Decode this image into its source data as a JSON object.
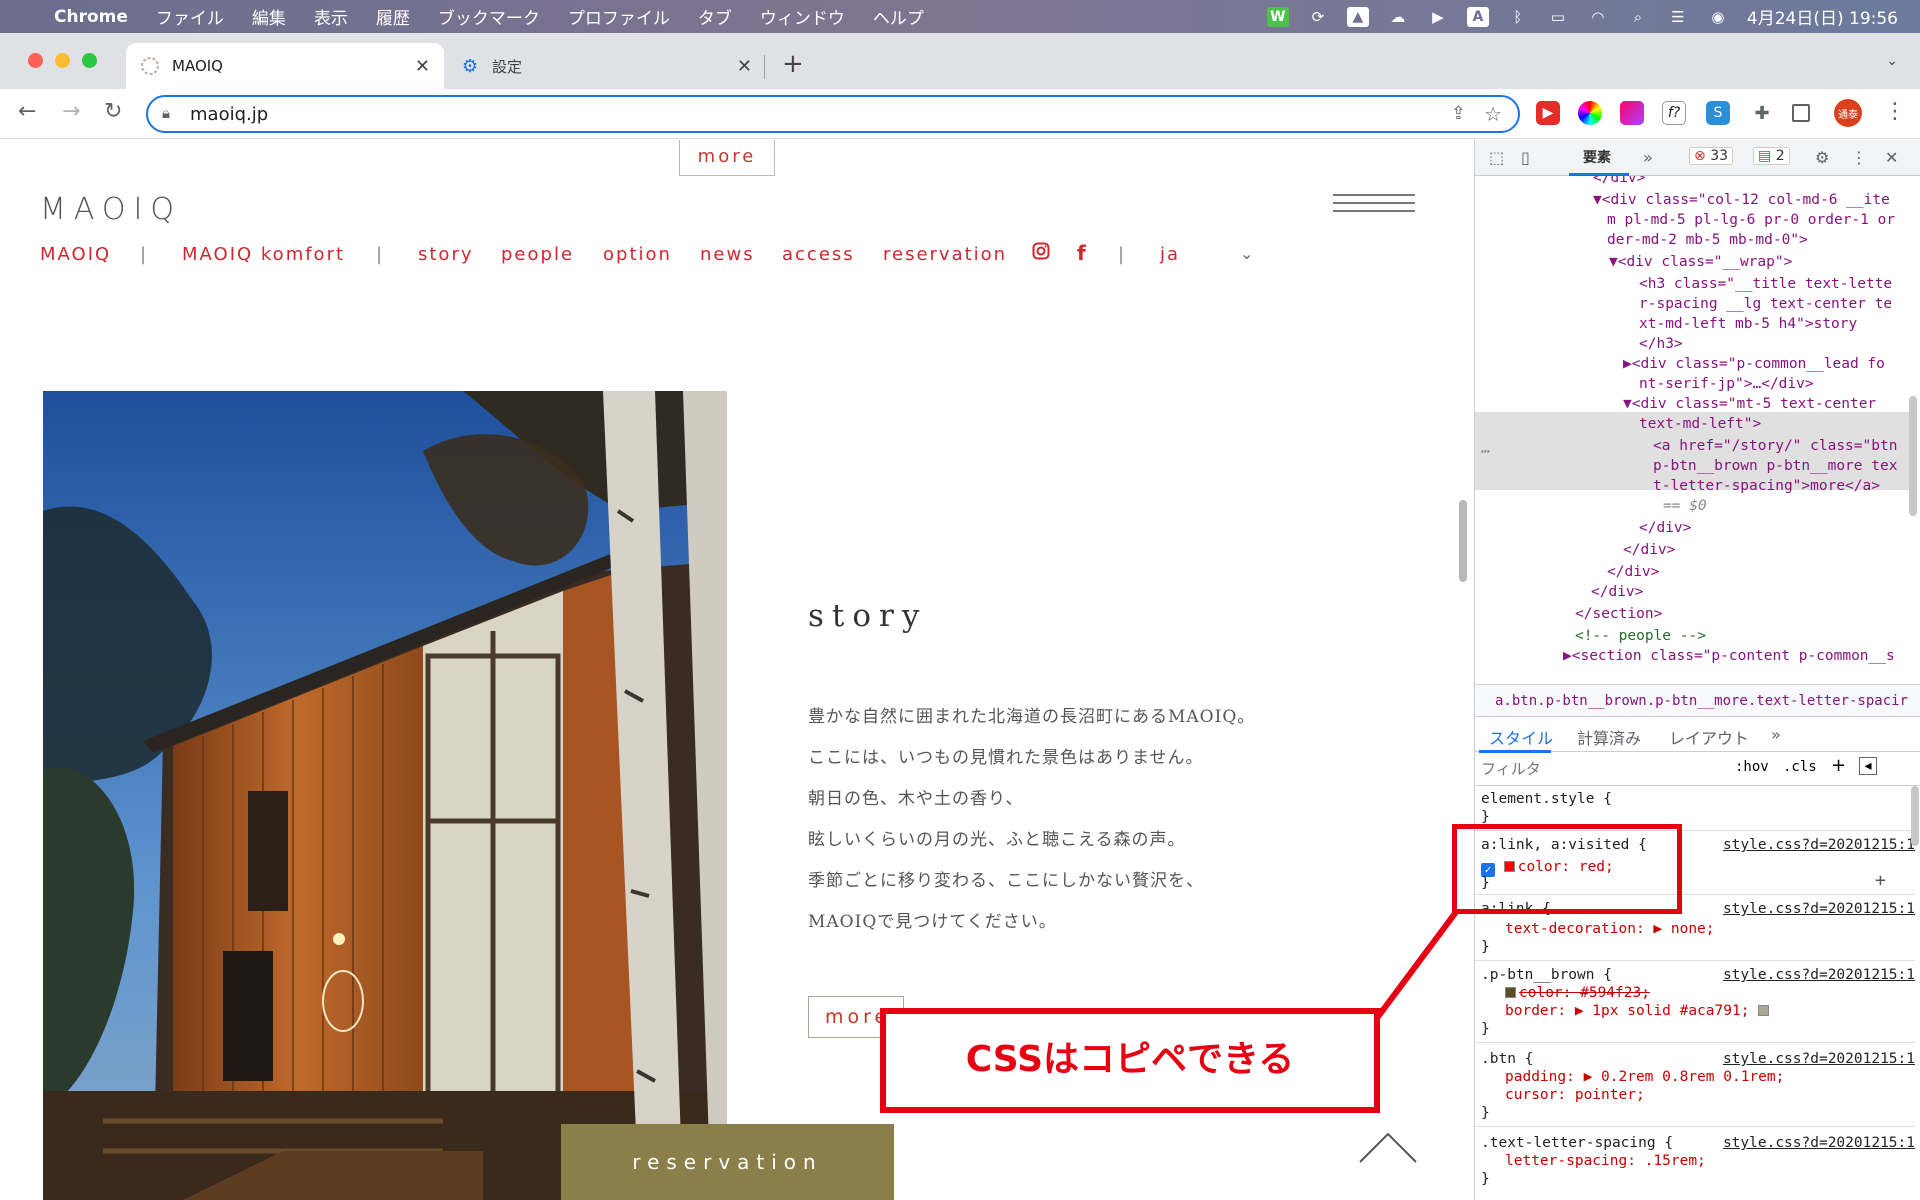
{
  "menubar": {
    "items": [
      "Chrome",
      "ファイル",
      "編集",
      "表示",
      "履歴",
      "ブックマーク",
      "プロファイル",
      "タブ",
      "ウィンドウ",
      "ヘルプ"
    ],
    "datetime": "4月24日(日) 19:56"
  },
  "tabs": [
    {
      "title": "MAOIQ"
    },
    {
      "title": "設定"
    }
  ],
  "address": {
    "url": "maoiq.jp"
  },
  "profile": {
    "badge": "通泰"
  },
  "page": {
    "more_top": "more",
    "logo": "MAOIQ",
    "nav": [
      "MAOIQ",
      "|",
      "MAOIQ komfort",
      "|",
      "story",
      "people",
      "option",
      "news",
      "access",
      "reservation",
      "|",
      "ja"
    ],
    "story_title": "story",
    "story_lines": [
      "豊かな自然に囲まれた北海道の長沼町にあるMAOIQ。",
      "ここには、いつもの見慣れた景色はありません。",
      "朝日の色、木や土の香り、",
      "眩しいくらいの月の光、ふと聴こえる森の声。",
      "季節ごとに移り変わる、ここにしかない贅沢を、",
      "MAOIQで見つけてください。"
    ],
    "more_button": "more",
    "reservation_button": "reservation"
  },
  "callout": {
    "text": "CSSはコピペできる",
    "color": "#e60012"
  },
  "devtools": {
    "tab_elements": "要素",
    "tab_more": "»",
    "errors": "33",
    "messages": "2",
    "dom_lines": [
      "</div>",
      "▼<div class=\"col-12 col-md-6 __ite",
      "m pl-md-5 pl-lg-6 pr-0 order-1 or",
      "der-md-2 mb-5 mb-md-0\">",
      "▼<div class=\"__wrap\">",
      "<h3 class=\"__title text-lette",
      "r-spacing __lg text-center te",
      "xt-md-left mb-5 h4\">story",
      "</h3>",
      "▶<div class=\"p-common__lead fo",
      "nt-serif-jp\">…</div>",
      "▼<div class=\"mt-5 text-center",
      "text-md-left\">",
      "<a href=\"/story/\" class=\"btn",
      "p-btn__brown p-btn__more tex",
      "t-letter-spacing\">more</a>",
      "== $0",
      "</div>",
      "</div>",
      "</div>",
      "</div>",
      "</section>",
      "<!-- people -->",
      "▶<section class=\"p-content p-common__s"
    ],
    "breadcrumb": "a.btn.p-btn__brown.p-btn__more.text-letter-spacir",
    "subtabs": [
      "スタイル",
      "計算済み",
      "レイアウト",
      "»"
    ],
    "filter_placeholder": "フィルタ",
    "hov": ":hov",
    "cls": ".cls",
    "rules": [
      {
        "selector": "element.style {",
        "source": "",
        "decls": [],
        "close": "}"
      },
      {
        "selector": "a:link, a:visited {",
        "source": "style.css?d=20201215:1",
        "decls": [
          {
            "text": "color: red;",
            "color": "#ff0000"
          }
        ],
        "close": "}"
      },
      {
        "selector": "a:link {",
        "source": "style.css?d=20201215:1",
        "decls": [
          {
            "text": "text-decoration: ▶ none;"
          }
        ],
        "close": "}"
      },
      {
        "selector": ".p-btn__brown {",
        "source": "style.css?d=20201215:1",
        "decls": [
          {
            "text": "color: #594f23;",
            "color": "#594f23",
            "struck": true
          },
          {
            "text": "border: ▶ 1px solid #aca791;",
            "color": "#aca791"
          }
        ],
        "close": "}"
      },
      {
        "selector": ".btn {",
        "source": "style.css?d=20201215:1",
        "decls": [
          {
            "text": "padding: ▶ 0.2rem 0.8rem 0.1rem;"
          },
          {
            "text": "cursor: pointer;"
          }
        ],
        "close": "}"
      },
      {
        "selector": ".text-letter-spacing {",
        "source": "style.css?d=20201215:1",
        "decls": [
          {
            "text": "letter-spacing: .15rem;"
          }
        ],
        "close": "}"
      }
    ]
  }
}
